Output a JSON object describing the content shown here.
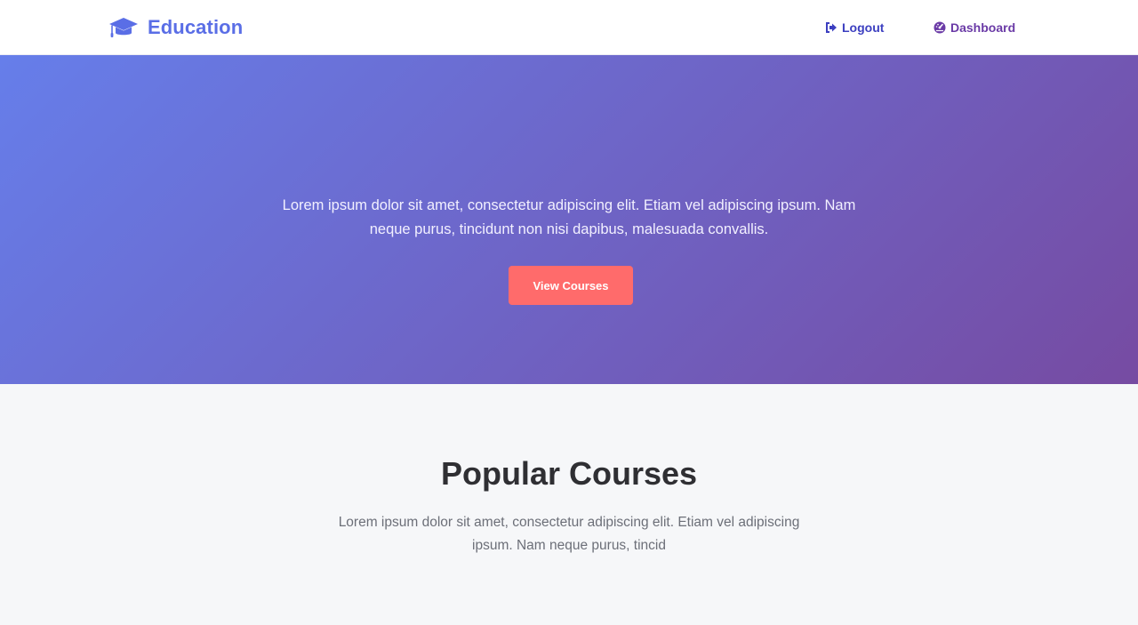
{
  "navbar": {
    "brand": {
      "label": "Education",
      "icon": "graduation-cap-icon",
      "color": "#5a6ee6"
    },
    "links": {
      "logout": {
        "label": "Logout",
        "icon": "sign-out-icon"
      },
      "dashboard": {
        "label": "Dashboard",
        "icon": "dashboard-icon"
      }
    }
  },
  "hero": {
    "text": "Lorem ipsum dolor sit amet, consectetur adipiscing elit. Etiam vel adipiscing ipsum. Nam neque purus, tincidunt non nisi dapibus, malesuada convallis.",
    "button_label": "View Courses",
    "gradient_start": "#667eea",
    "gradient_end": "#764ba2",
    "button_color": "#ff6b6b"
  },
  "courses": {
    "title": "Popular Courses",
    "subtitle": "Lorem ipsum dolor sit amet, consectetur adipiscing elit. Etiam vel adipiscing ipsum. Nam neque purus, tincid"
  }
}
